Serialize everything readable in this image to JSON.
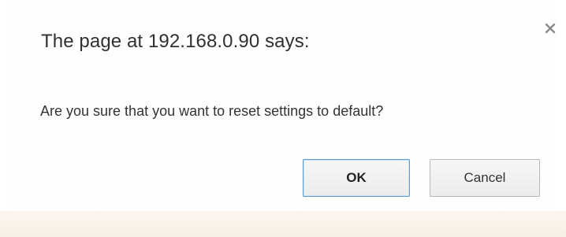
{
  "dialog": {
    "title": "The page at 192.168.0.90 says:",
    "message": "Are you sure that you want to reset settings to default?",
    "close_icon": "close-icon",
    "buttons": {
      "ok_label": "OK",
      "cancel_label": "Cancel"
    }
  }
}
